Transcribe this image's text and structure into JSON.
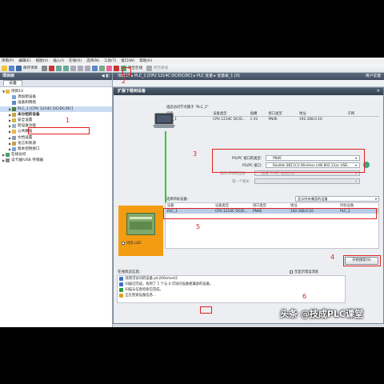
{
  "menubar": {
    "items": [
      "项目(P)",
      "编辑(E)",
      "视图(V)",
      "插入(I)",
      "在线(O)",
      "选项(N)",
      "工具(T)",
      "窗口(W)",
      "帮助(H)"
    ]
  },
  "toolbar": {
    "save_label": "保存项目",
    "online_label": "转至在线",
    "offline_label": "转至离线"
  },
  "left_panel": {
    "title": "项目树",
    "tab": "设备",
    "tree": [
      {
        "label": "项目14",
        "level": 0,
        "arrow": "▼"
      },
      {
        "label": "添加新设备",
        "level": 1,
        "arrow": ""
      },
      {
        "label": "设备和网络",
        "level": 1,
        "arrow": ""
      },
      {
        "label": "PLC_1 [CPU 1214C DC/DC/DC]",
        "level": 1,
        "arrow": "▶",
        "selected": true
      },
      {
        "label": "未分组的设备",
        "level": 1,
        "arrow": "▶",
        "bold": true
      },
      {
        "label": "安全设置",
        "level": 1,
        "arrow": "▶"
      },
      {
        "label": "跨设备功能",
        "level": 1,
        "arrow": "▶"
      },
      {
        "label": "公共数据",
        "level": 1,
        "arrow": "▶"
      },
      {
        "label": "文档设置",
        "level": 1,
        "arrow": "▶"
      },
      {
        "label": "语言和资源",
        "level": 1,
        "arrow": "▶"
      },
      {
        "label": "版本控制接口",
        "level": 1,
        "arrow": "▶"
      },
      {
        "label": "在线访问",
        "level": 0,
        "arrow": "▶"
      },
      {
        "label": "读卡器/USB 存储器",
        "level": 0,
        "arrow": "▶"
      }
    ]
  },
  "main_bar": {
    "breadcrumb": "项目14 ▸ PLC_1 [CPU 1214C DC/DC/DC] ▸ PLC 变量 ▸ 变量表_1 [0]",
    "right": "用户常量"
  },
  "dialog": {
    "title": "扩展下载到设备",
    "config_caption": "组态访问节点属于 \"PLC_1\"",
    "config_headers": [
      "设备",
      "设备类型",
      "插槽",
      "接口类型",
      "地址",
      "子网"
    ],
    "config_rows": [
      [
        "PLC_1",
        "CPU 1214C DC/D...",
        "1 X1",
        "PN/IE",
        "192.168.0.10",
        ""
      ]
    ],
    "pgpc_type_label": "PG/PC 接口的类型:",
    "pgpc_type_value": "PN/IE",
    "pgpc_iface_label": "PG/PC 接口:",
    "pgpc_iface_value": "Realtek 8811CU Wireless LAN 802.11ac USB...",
    "subnet_conn_label": "接口/子网的连接:",
    "subnet_conn_value": "插槽 \"1 X1\" 处的方向",
    "gateway_label": "第一个网关:",
    "target_caption": "选择目标设备:",
    "target_filter": "显示所有兼容的设备",
    "target_headers": [
      "设备",
      "设备类型",
      "接口类型",
      "地址",
      "目标设备"
    ],
    "target_rows": [
      [
        "PLC_1",
        "CPU 1214C DC/D...",
        "PN/IE",
        "192.168.0.10",
        "PLC_1"
      ]
    ],
    "flash_led": "闪烁 LED",
    "search_button": "开始搜索(S)",
    "status_caption": "在线状态信息:",
    "status_checkbox": "仅显示错误消息",
    "status_rows": [
      {
        "icon": "info",
        "text": "找到可访问的设备 plc200smart2"
      },
      {
        "icon": "info",
        "text": "扫描已完成。找到了 1 个与 4 可访问设备相兼容的设备。"
      },
      {
        "icon": "ok",
        "text": "扫描与信息检索已完成。"
      },
      {
        "icon": "warn",
        "text": "正在检索设备信息..."
      }
    ]
  },
  "annotations": [
    "1",
    "2",
    "3",
    "4",
    "5",
    "6"
  ],
  "watermark": "头条 @技成PLC课堂",
  "colors": {
    "annotation": "#e02020",
    "selected_row": "#b7cde8",
    "plc_panel": "#f39c12",
    "link_line": "#2ecc40"
  }
}
